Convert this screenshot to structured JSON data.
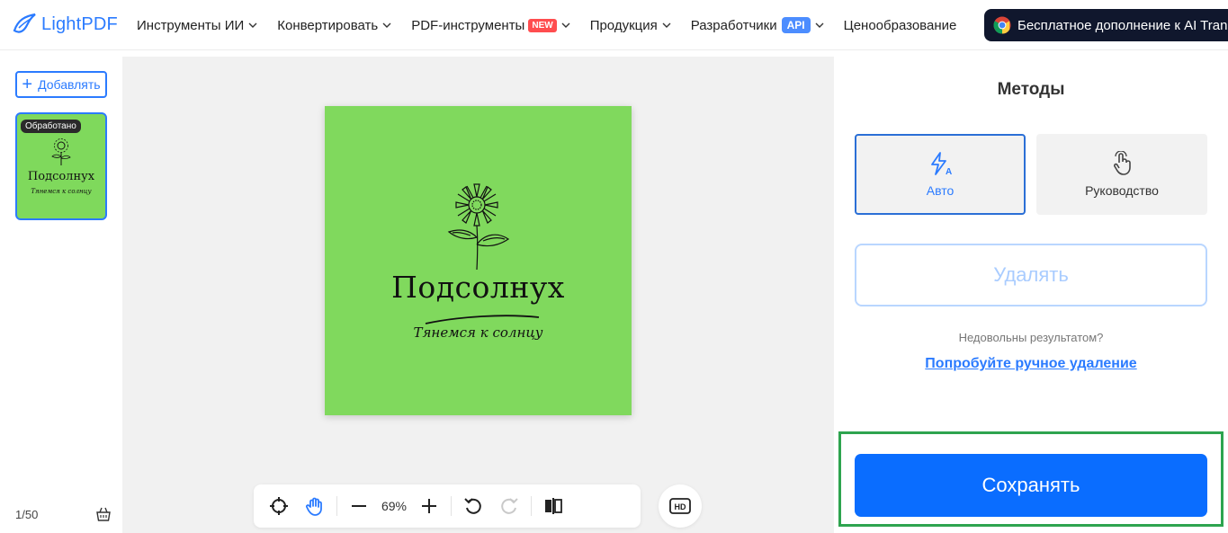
{
  "logo": {
    "text": "LightPDF"
  },
  "nav": {
    "items": [
      {
        "label": "Инструменты ИИ",
        "badge": ""
      },
      {
        "label": "Конвертировать",
        "badge": ""
      },
      {
        "label": "PDF-инструменты",
        "badge": "NEW"
      },
      {
        "label": "Продукция",
        "badge": ""
      },
      {
        "label": "Разработчики",
        "badge": "API"
      }
    ],
    "pricing": "Ценообразование",
    "extension_button": "Бесплатное дополнение к AI Trans"
  },
  "sidebar": {
    "add_label": "Добавлять",
    "thumbnail": {
      "badge": "Обработано",
      "title": "Подсолнух",
      "subtitle": "Тянемся к солнцу"
    },
    "page_count": "1/50"
  },
  "canvas": {
    "image": {
      "title": "Подсолнух",
      "subtitle": "Тянемся к солнцу",
      "background_color": "#80d95d"
    },
    "toolbar": {
      "zoom": "69%"
    },
    "hd_label": "HD"
  },
  "panel": {
    "title": "Методы",
    "methods": [
      {
        "label": "Авто",
        "icon": "auto-lightning-icon",
        "active": true
      },
      {
        "label": "Руководство",
        "icon": "hand-pointer-icon",
        "active": false
      }
    ],
    "remove_label": "Удалять",
    "hint": "Недовольны результатом?",
    "manual_link": "Попробуйте ручное удаление",
    "save_label": "Сохранять"
  },
  "colors": {
    "accent": "#2b7bff",
    "save": "#0a6dff",
    "highlight_frame": "#2ea44f",
    "new_badge": "#ff4d4f"
  }
}
